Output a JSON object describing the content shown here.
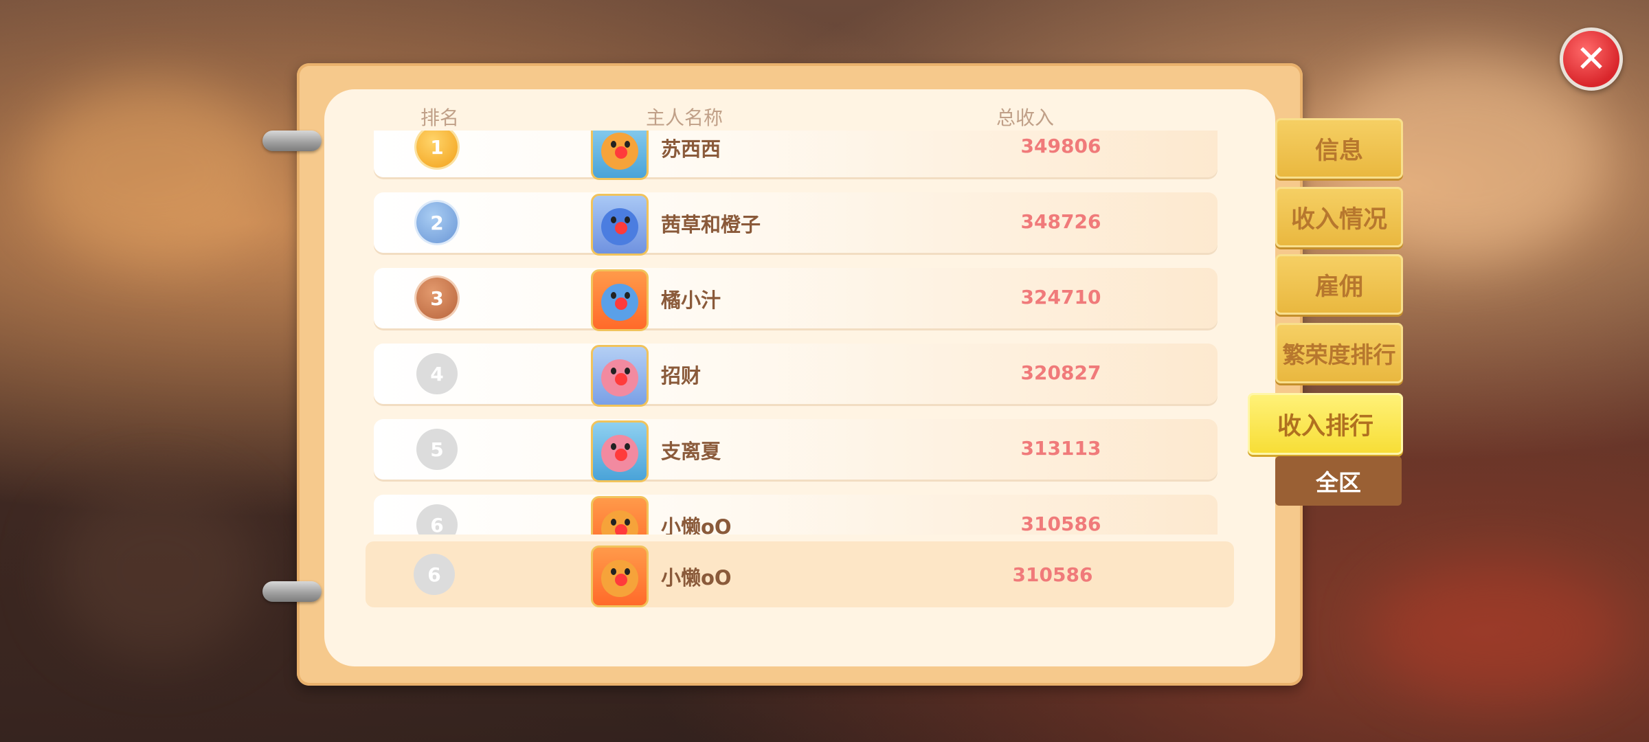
{
  "header": {
    "rank": "排名",
    "name": "主人名称",
    "income": "总收入"
  },
  "rows": [
    {
      "rank": "1",
      "name": "苏西西",
      "income": "349806",
      "badge": "gold"
    },
    {
      "rank": "2",
      "name": "茜草和橙子",
      "income": "348726",
      "badge": "silver"
    },
    {
      "rank": "3",
      "name": "橘小汁",
      "income": "324710",
      "badge": "bronze"
    },
    {
      "rank": "4",
      "name": "招财",
      "income": "320827",
      "badge": "plain"
    },
    {
      "rank": "5",
      "name": "支离夏",
      "income": "313113",
      "badge": "plain"
    },
    {
      "rank": "6",
      "name": "小懒oO",
      "income": "310586",
      "badge": "plain"
    }
  ],
  "my_rank": {
    "rank": "6",
    "name": "小懒oO",
    "income": "310586"
  },
  "tabs": [
    "信息",
    "收入情况",
    "雇佣",
    "繁荣度排行",
    "收入排行"
  ],
  "active_tab": "收入排行",
  "sub_tab": "全区",
  "colors": {
    "accent_tab": "#f7dd34",
    "income_text": "#f07a7a",
    "name_text": "#8a5a3a"
  }
}
